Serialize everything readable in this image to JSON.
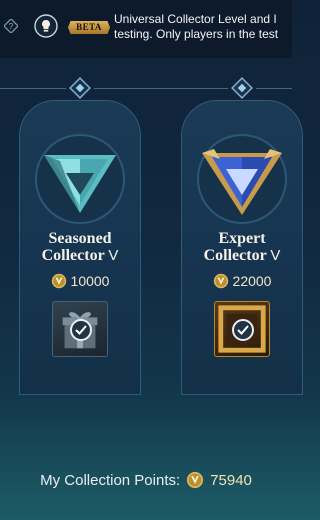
{
  "banner": {
    "beta_label": "BETA",
    "line1": "Universal Collector Level and I",
    "line2": "testing. Only players in the test"
  },
  "tiers": [
    {
      "name_line1": "Seasoned",
      "name_line2": "Collector",
      "rank": "V",
      "points": "10000",
      "emblem_color": "#7fd6d8"
    },
    {
      "name_line1": "Expert",
      "name_line2": "Collector",
      "rank": "V",
      "points": "22000",
      "emblem_color": "#4a73e0"
    }
  ],
  "footer": {
    "label": "My Collection Points:",
    "value": "75940"
  },
  "colors": {
    "accent_gold": "#d9b45a",
    "rail_blue": "#4f86a8"
  },
  "icons": [
    "help-icon",
    "lightbulb-icon",
    "collector-coin-icon",
    "check-icon"
  ]
}
